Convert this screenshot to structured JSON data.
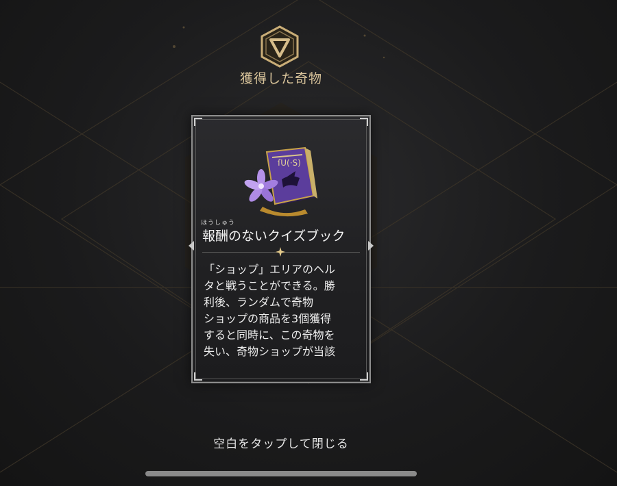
{
  "header": {
    "title": "獲得した奇物",
    "emblem_icon": "relic-emblem-icon",
    "accent_color": "#c9ad77"
  },
  "card": {
    "item_icon": "purple-quiz-book-icon",
    "name_ruby": "ほうしゅう",
    "name": "報酬のないクイズブック",
    "description_lines": [
      "「ショップ」エリアのヘル",
      "タと戦うことができる。勝",
      "利後、ランダムで奇物",
      "ショップの商品を3個獲得",
      "すると同時に、この奇物を",
      "失い、奇物ショップが当該"
    ]
  },
  "footer": {
    "close_hint": "空白をタップして閉じる"
  }
}
